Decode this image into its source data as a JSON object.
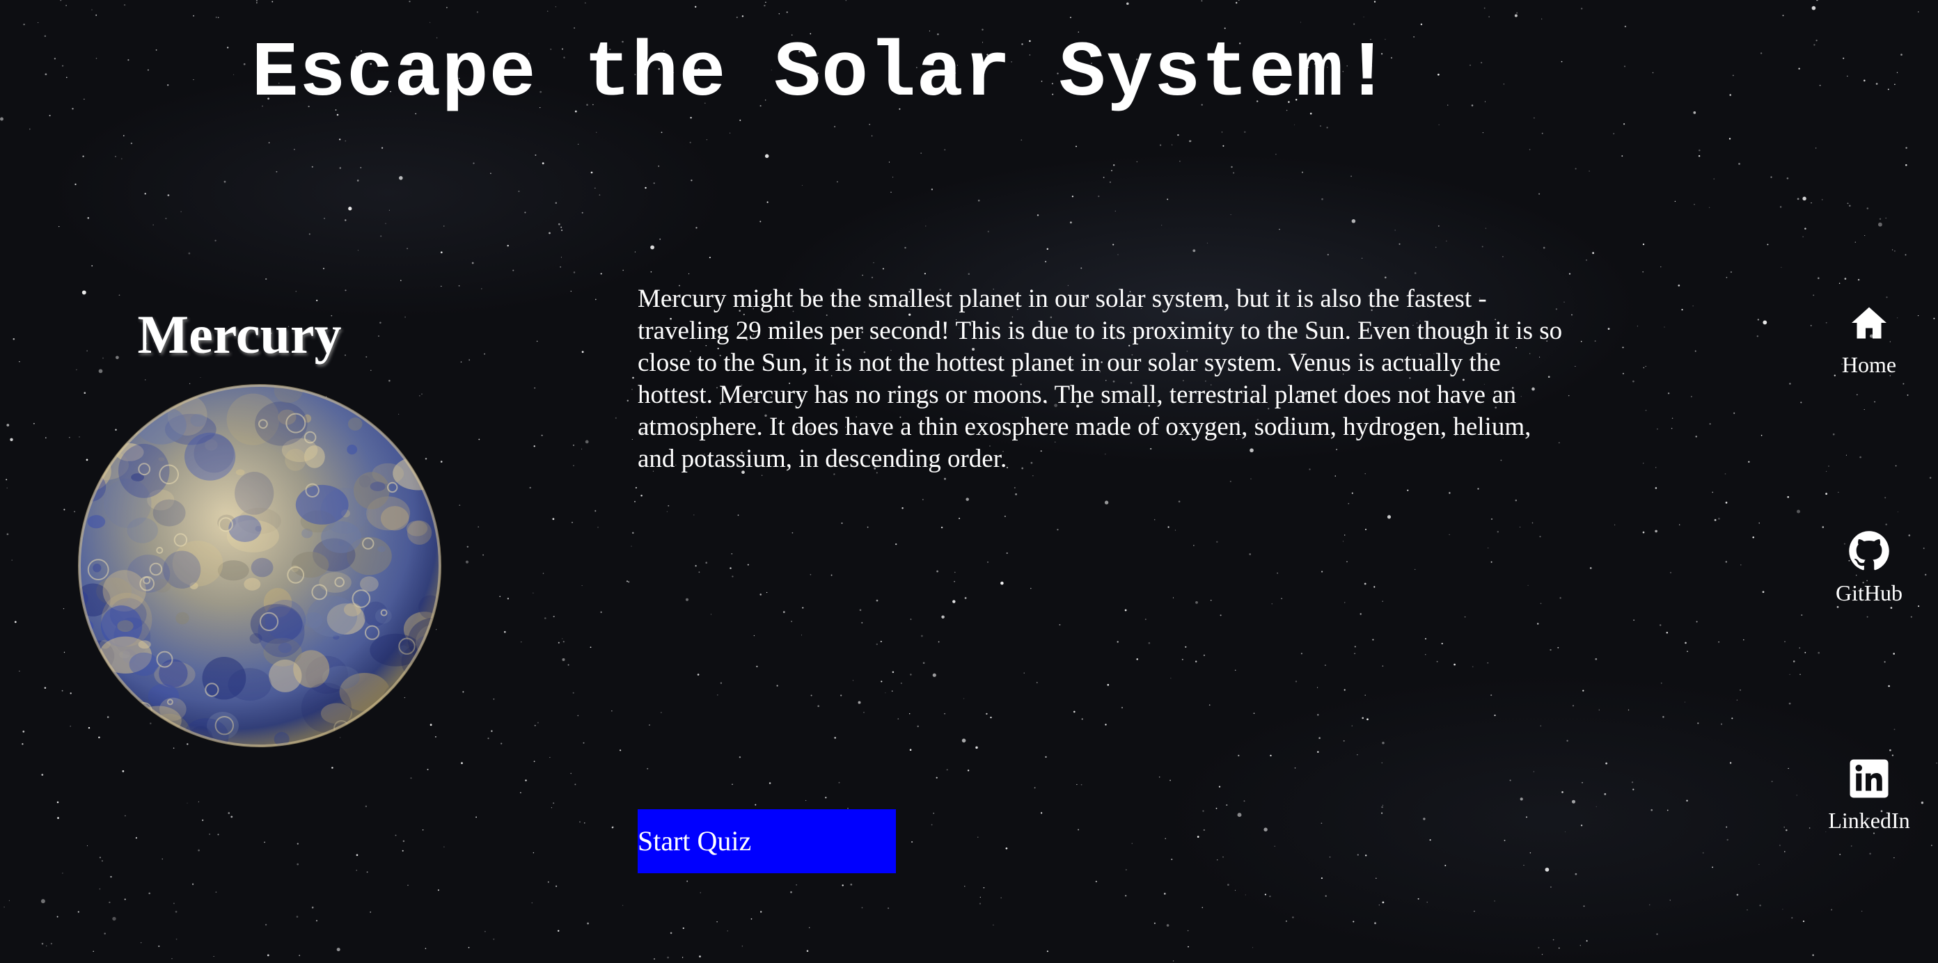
{
  "page": {
    "title": "Escape the Solar System!"
  },
  "planet": {
    "name": "Mercury",
    "image_alt": "Mercury planet",
    "description": "Mercury might be the smallest planet in our solar system, but it is also the fastest - traveling 29 miles per second! This is due to its proximity to the Sun. Even though it is so close to the Sun, it is not the hottest planet in our solar system. Venus is actually the hottest. Mercury has no rings or moons. The small, terrestrial planet does not have an atmosphere. It does have a thin exosphere made of oxygen, sodium, hydrogen, helium, and potassium, in descending order."
  },
  "quiz": {
    "start_label": "Start Quiz",
    "button_color": "#0000ff"
  },
  "nav": {
    "items": [
      {
        "label": "Home",
        "icon": "home-icon"
      },
      {
        "label": "GitHub",
        "icon": "github-icon"
      },
      {
        "label": "LinkedIn",
        "icon": "linkedin-icon"
      }
    ]
  },
  "colors": {
    "background": "#0d0e12",
    "text": "#ffffff"
  }
}
